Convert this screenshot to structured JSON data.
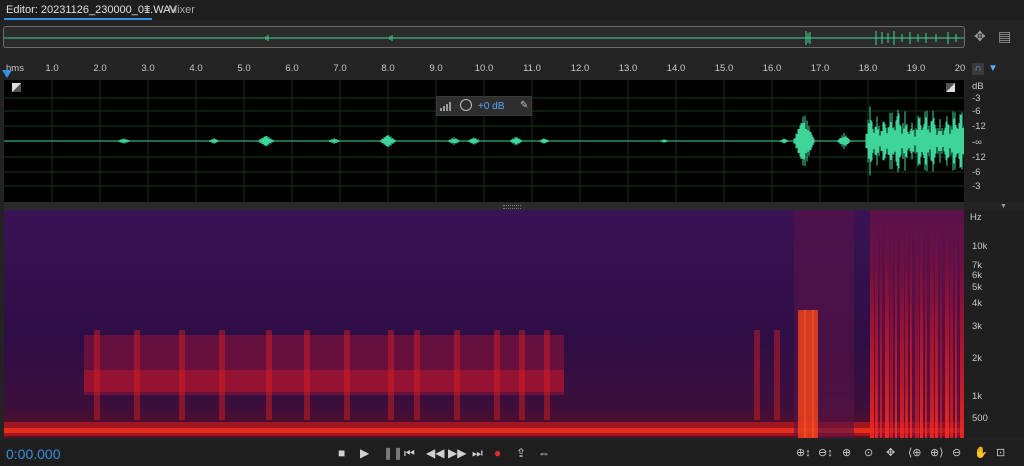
{
  "tabs": {
    "editor_label": "Editor: 20231126_230000_01.WAV",
    "menu_glyph": "≡",
    "mixer_label": "Mixer"
  },
  "icons": {
    "overview_zoom": "zoom-to-fit-icon",
    "overview_list": "list-icon",
    "magnet": "snap-magnet-icon",
    "marker": "marker-icon"
  },
  "ruler": {
    "unit": "hms",
    "ticks": [
      "1.0",
      "2.0",
      "3.0",
      "4.0",
      "5.0",
      "6.0",
      "7.0",
      "8.0",
      "9.0",
      "10.0",
      "11.0",
      "12.0",
      "13.0",
      "14.0",
      "15.0",
      "16.0",
      "17.0",
      "18.0",
      "19.0",
      "20"
    ]
  },
  "wave_scale": {
    "unit": "dB",
    "labels": [
      "-3",
      "-6",
      "-12",
      "-∞",
      "-12",
      "-6",
      "-3"
    ]
  },
  "hud": {
    "volume_value": "+0 dB"
  },
  "spectral_scale": {
    "unit": "Hz",
    "labels": [
      "10k",
      "7k",
      "6k",
      "5k",
      "4k",
      "3k",
      "2k",
      "1k",
      "500"
    ]
  },
  "transport": {
    "timecode": "0:00.000"
  },
  "colors": {
    "accent": "#3b8fe0",
    "waveform": "#3fd49a",
    "spectral_bg": "#2a0d3e",
    "spectral_hot": "#ff2a1a"
  }
}
